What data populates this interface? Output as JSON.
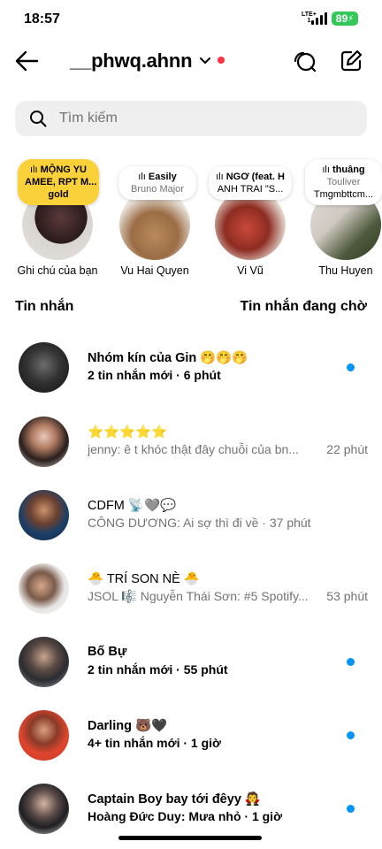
{
  "status": {
    "time": "18:57",
    "network_top": "LTE+",
    "network_bottom": "1",
    "battery": "89"
  },
  "header": {
    "username": "__phwq.ahnn"
  },
  "search": {
    "placeholder": "Tìm kiếm"
  },
  "notes": [
    {
      "line1": "MỘNG YU",
      "line2": "AMEE, RPT M...",
      "line3": "gold",
      "label": "Ghi chú của bạn"
    },
    {
      "line1": "Easily",
      "line2": "Bruno Major",
      "label": "Vu Hai Quyen"
    },
    {
      "line1": "NGƠ (feat. H",
      "line2": "ANH TRAI \"S...",
      "label": "Vi Vũ"
    },
    {
      "line1": "thuâng",
      "line2": "Touliver",
      "line3": "Tmgmbttcm...",
      "label": "Thu Huyen"
    }
  ],
  "tabs": {
    "messages": "Tin nhắn",
    "requests": "Tin nhắn đang chờ"
  },
  "threads": [
    {
      "name": "Nhóm kín của Gin 🤭🤭🤭",
      "preview": "2 tin nhắn mới",
      "time": "6 phút",
      "unread": true
    },
    {
      "name": "⭐⭐⭐⭐⭐",
      "preview": "jenny: ê t khóc thật đây chuỗi của bn...",
      "time": "22 phút",
      "unread": false
    },
    {
      "name": "CDFM 📡🩶💬",
      "preview": "CÔNG DƯƠNG: Ai sợ thì đi về",
      "time": "37 phút",
      "unread": false
    },
    {
      "name": "🐣 TRÍ SON NÈ 🐣",
      "preview": "JSOL 🎼 Nguyễn Thái Sơn: #5 Spotify...",
      "time": "53 phút",
      "unread": false
    },
    {
      "name": "Bố Bự",
      "preview": "2 tin nhắn mới",
      "time": "55 phút",
      "unread": true
    },
    {
      "name": "Darling 🐻🖤",
      "preview": "4+ tin nhắn mới",
      "time": "1 giờ",
      "unread": true
    },
    {
      "name": "Captain Boy bay tới đêyy 🧛",
      "preview": "Hoàng Đức Duy: Mưa nhỏ",
      "time": "1 giờ",
      "unread": true
    }
  ],
  "colors": {
    "accent": "#0095f6",
    "note_highlight": "#fbd13a",
    "online_dot": "#ff3040",
    "battery": "#34c759"
  }
}
